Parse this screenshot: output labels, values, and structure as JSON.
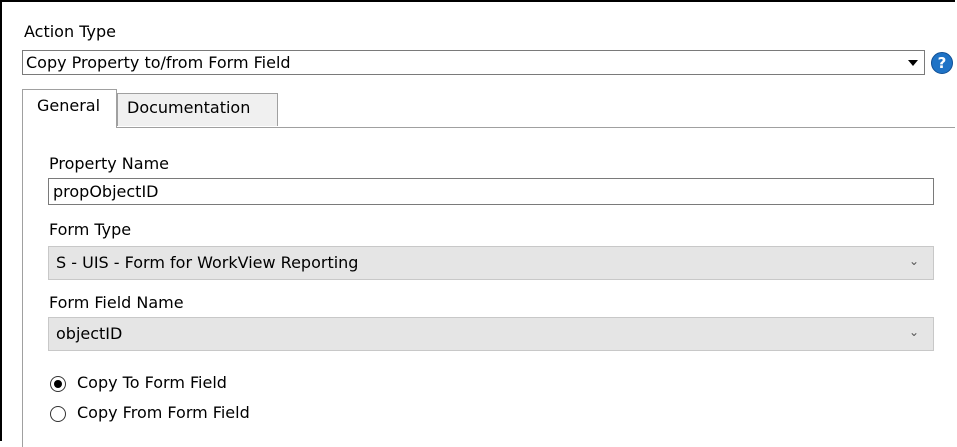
{
  "action_type": {
    "label": "Action Type",
    "value": "Copy Property to/from Form Field",
    "help_glyph": "?"
  },
  "tabs": [
    {
      "label": "General",
      "selected": true
    },
    {
      "label": "Documentation",
      "selected": false
    }
  ],
  "general": {
    "property_name_label": "Property Name",
    "property_name_value": "propObjectID",
    "form_type_label": "Form Type",
    "form_type_value": "S - UIS - Form for WorkView Reporting",
    "form_field_name_label": "Form Field Name",
    "form_field_name_value": "objectID",
    "copy_direction": {
      "options": [
        {
          "label": "Copy To Form Field",
          "checked": true
        },
        {
          "label": "Copy From Form Field",
          "checked": false
        }
      ]
    }
  },
  "colors": {
    "help_icon": "#1f73c6",
    "select_bg": "#e5e5e5",
    "tab_border": "#a0a0a0"
  },
  "icons": {
    "help": "help-icon",
    "dropdown": "dropdown-arrow-icon",
    "chevron": "chevron-down-icon"
  }
}
